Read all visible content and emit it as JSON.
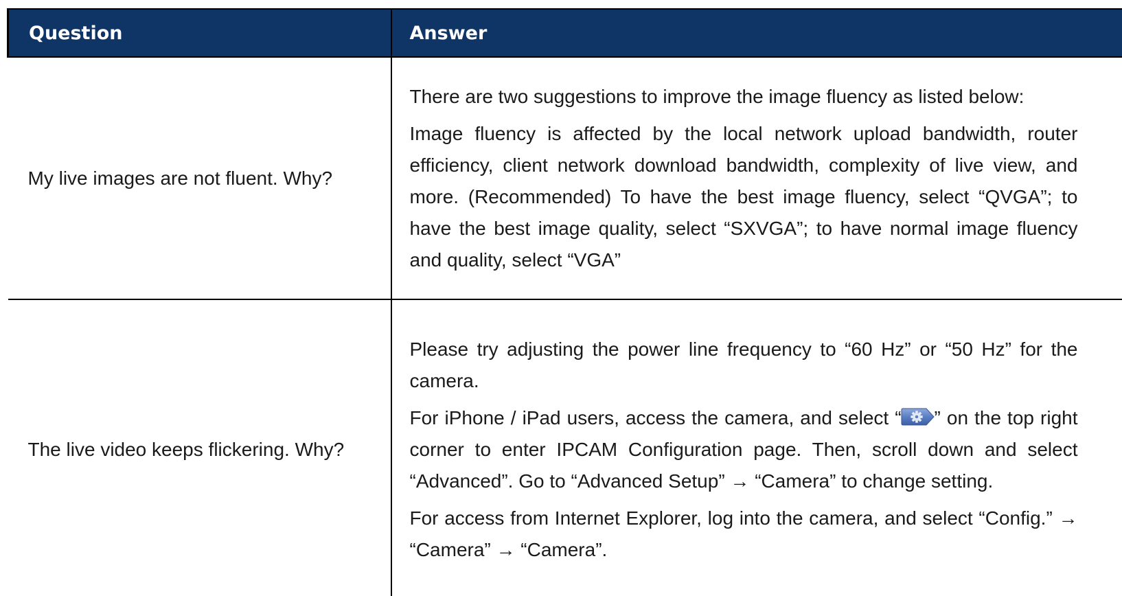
{
  "table": {
    "headers": {
      "question": "Question",
      "answer": "Answer"
    },
    "rows": [
      {
        "question": "My live images are not fluent. Why?",
        "answer_paragraphs": [
          "There are two suggestions to improve the image fluency as listed below:",
          "Image fluency is affected by the local network upload bandwidth, router efficiency, client network download bandwidth, complexity of live view, and more. (Recommended) To have the best image fluency, select “QVGA”; to have the best image quality, select “SXVGA”; to have normal image fluency and quality, select “VGA”"
        ]
      },
      {
        "question": "The live video keeps flickering. Why?",
        "answer_paragraphs": [
          "Please try adjusting the power line frequency to “60 Hz” or “50 Hz” for the camera.",
          {
            "before_icon": "For iPhone / iPad users, access the camera, and select “",
            "icon": "gear-settings-icon",
            "after_icon": "” on the top right corner to enter IPCAM Configuration page. Then, scroll down and select “Advanced”. Go to “Advanced Setup” → “Camera” to change setting."
          },
          "For access from Internet Explorer, log into the camera, and select “Config.” → “Camera” → “Camera”."
        ]
      }
    ]
  },
  "colors": {
    "header_bg": "#0e3566",
    "header_text": "#ffffff",
    "icon_bg": "#5b7fc4"
  }
}
